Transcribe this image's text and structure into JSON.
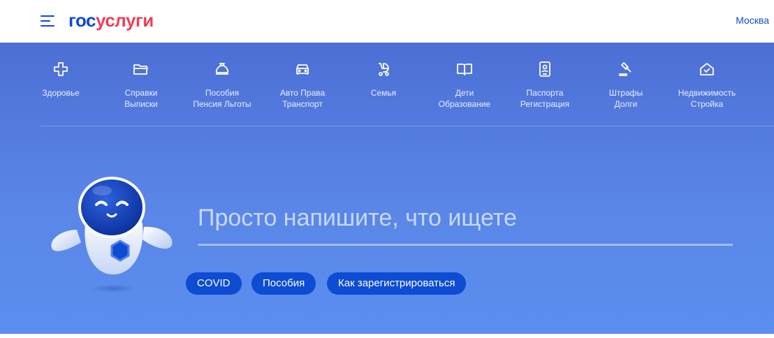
{
  "header": {
    "logo_part1": "гос",
    "logo_part2": "услуги",
    "city": "Москва"
  },
  "categories": [
    {
      "icon": "health-cross-icon",
      "line1": "Здоровье",
      "line2": ""
    },
    {
      "icon": "folder-icon",
      "line1": "Справки",
      "line2": "Выписки"
    },
    {
      "icon": "money-bag-icon",
      "line1": "Пособия",
      "line2": "Пенсия Льготы"
    },
    {
      "icon": "car-icon",
      "line1": "Авто Права",
      "line2": "Транспорт"
    },
    {
      "icon": "stroller-icon",
      "line1": "Семья",
      "line2": ""
    },
    {
      "icon": "book-icon",
      "line1": "Дети",
      "line2": "Образование"
    },
    {
      "icon": "passport-icon",
      "line1": "Паспорта",
      "line2": "Регистрация"
    },
    {
      "icon": "gavel-icon",
      "line1": "Штрафы",
      "line2": "Долги"
    },
    {
      "icon": "house-check-icon",
      "line1": "Недвижимость",
      "line2": "Стройка"
    }
  ],
  "search": {
    "placeholder": "Просто напишите, что ищете",
    "value": ""
  },
  "chips": [
    "COVID",
    "Пособия",
    "Как зарегистрироваться"
  ],
  "colors": {
    "brand_blue": "#0d4cd3",
    "brand_red": "#ee3f58",
    "hero_top": "#4c6fd5",
    "hero_bottom": "#5a8ef0"
  }
}
